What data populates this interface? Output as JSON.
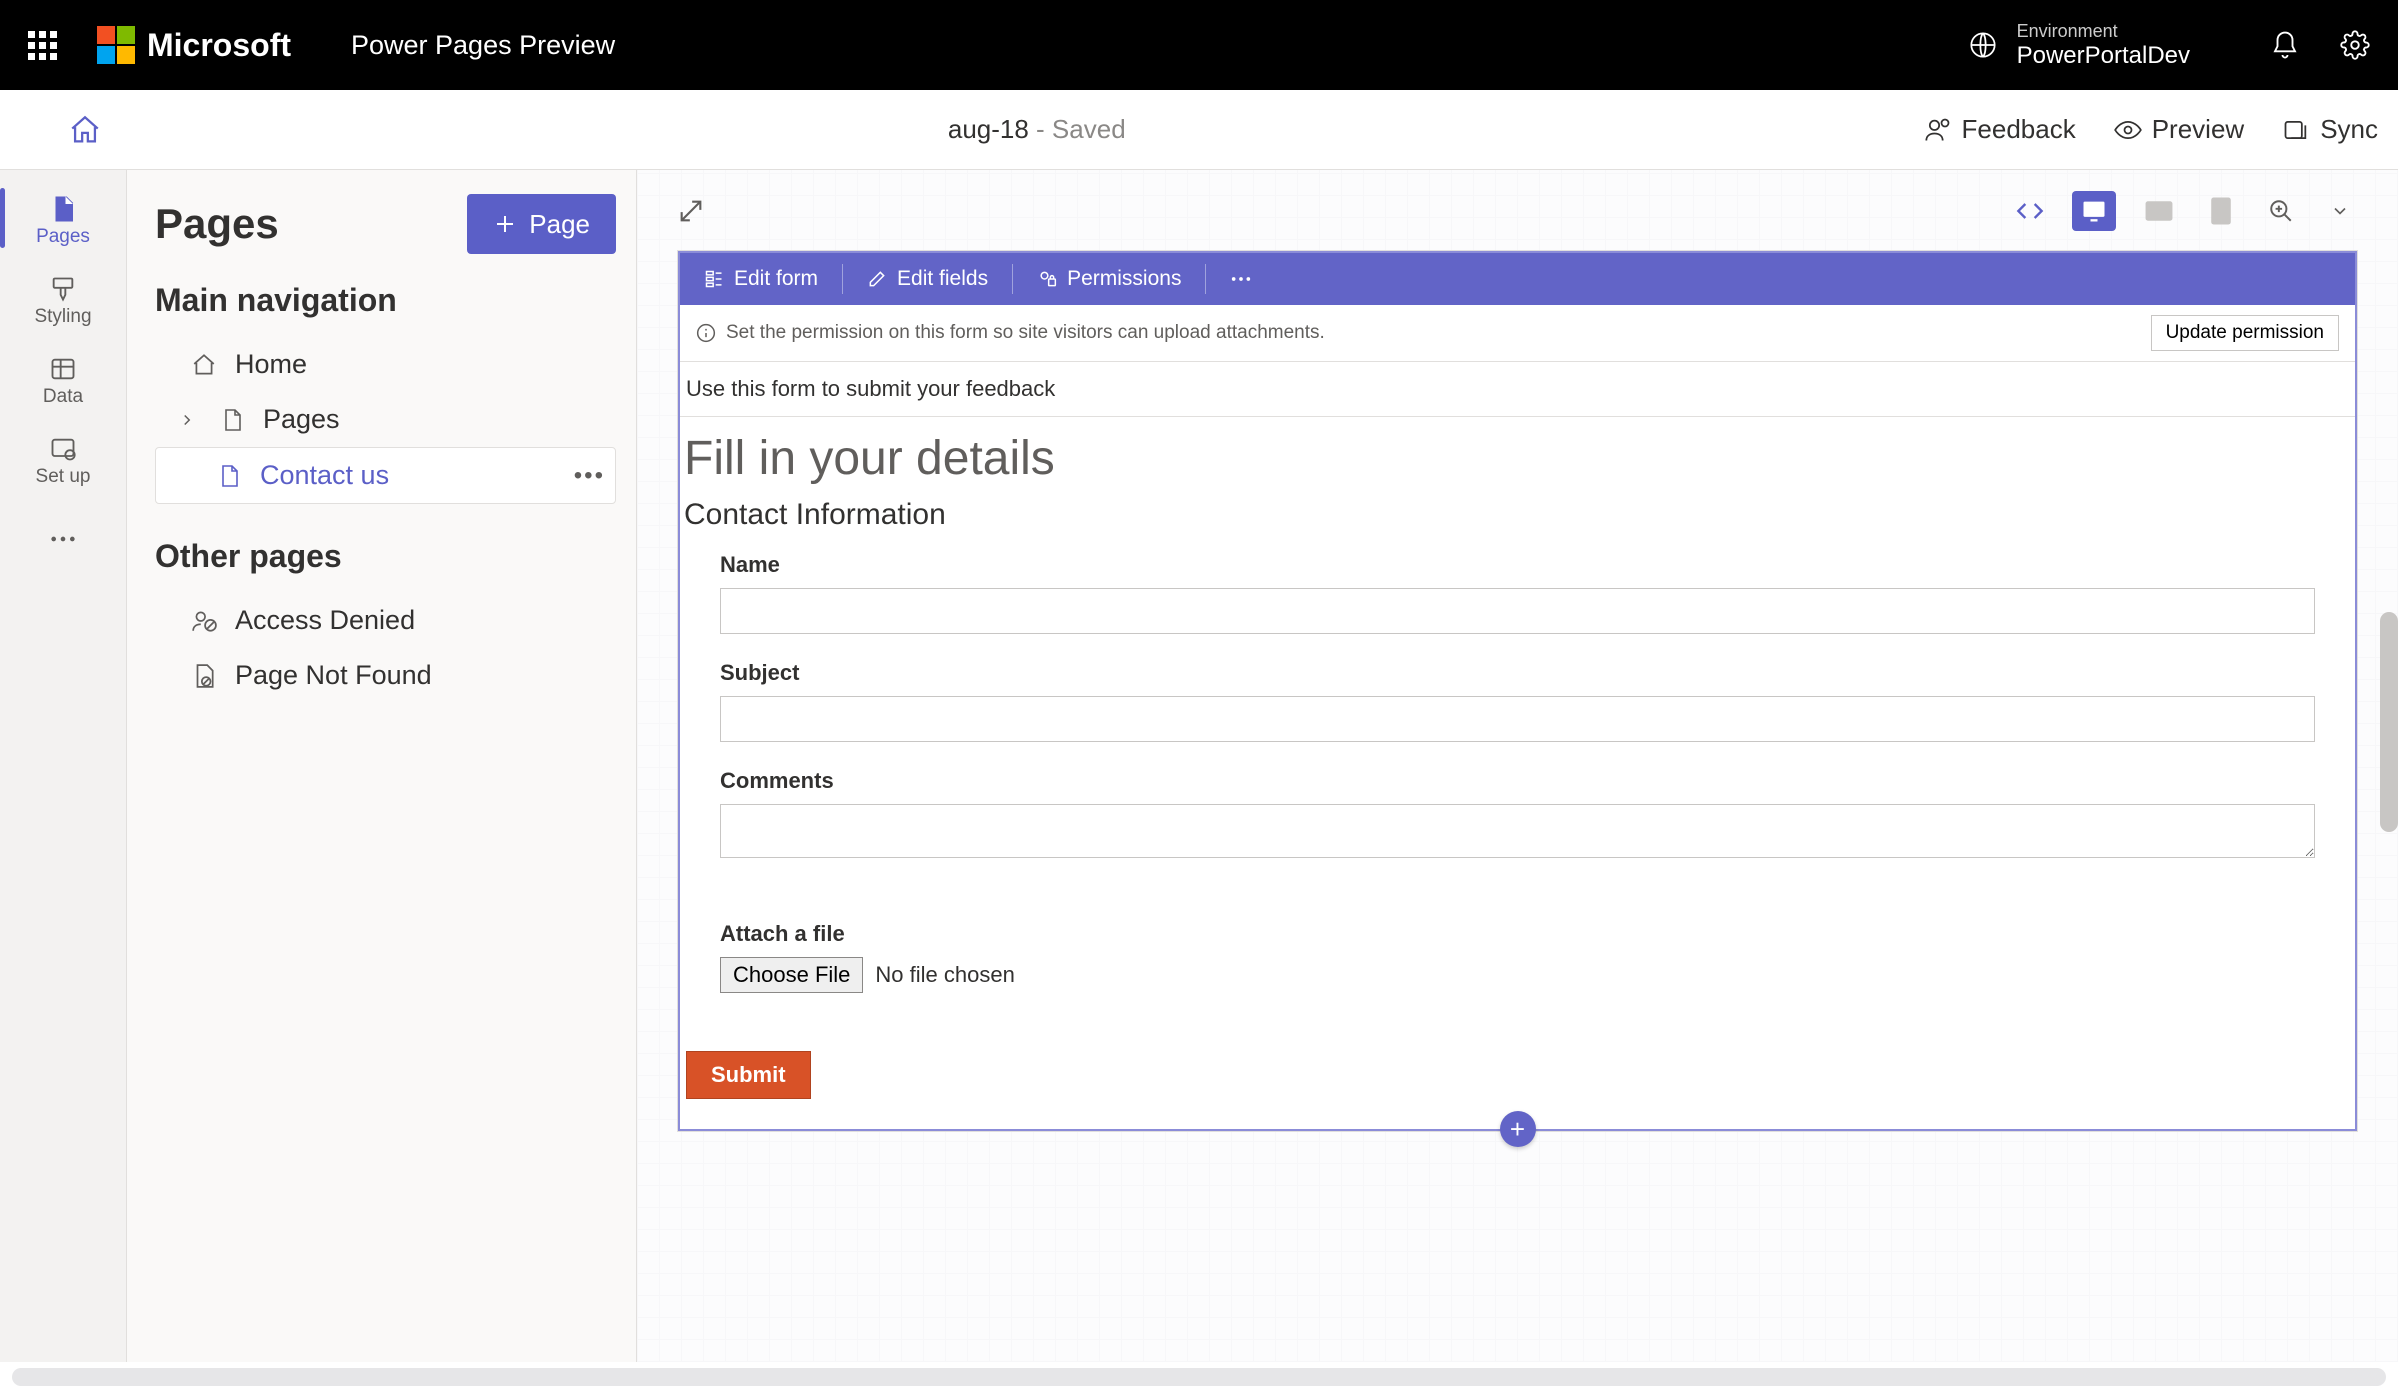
{
  "header": {
    "brand_name": "Microsoft",
    "product_name": "Power Pages Preview",
    "env_label": "Environment",
    "env_name": "PowerPortalDev"
  },
  "subheader": {
    "doc_name": "aug-18",
    "doc_state": " - Saved",
    "feedback": "Feedback",
    "preview": "Preview",
    "sync": "Sync"
  },
  "rail": {
    "pages": "Pages",
    "styling": "Styling",
    "data": "Data",
    "setup": "Set up"
  },
  "panel": {
    "title": "Pages",
    "add_page": "Page",
    "main_nav": "Main navigation",
    "home": "Home",
    "pages": "Pages",
    "contact_us": "Contact us",
    "other_pages": "Other pages",
    "access_denied": "Access Denied",
    "page_not_found": "Page Not Found"
  },
  "form": {
    "edit_form": "Edit form",
    "edit_fields": "Edit fields",
    "permissions": "Permissions",
    "perm_banner": "Set the permission on this form so site visitors can upload attachments.",
    "update_perm": "Update permission",
    "desc": "Use this form to submit your feedback",
    "title": "Fill in your details",
    "section": "Contact Information",
    "name_label": "Name",
    "subject_label": "Subject",
    "comments_label": "Comments",
    "attach_label": "Attach a file",
    "choose_file": "Choose File",
    "no_file": "No file chosen",
    "submit": "Submit"
  }
}
